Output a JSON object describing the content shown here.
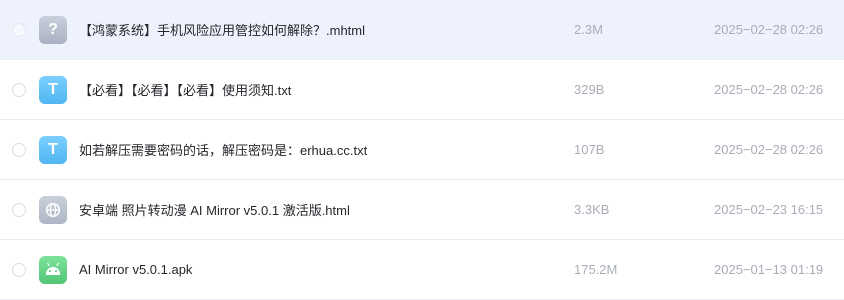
{
  "files": [
    {
      "name": "【鸿蒙系统】手机风险应用管控如何解除？.mhtml",
      "size": "2.3M",
      "date": "2025−02−28 02:26",
      "icon": "unknown-file-icon",
      "icon_glyph": "?",
      "selected": true
    },
    {
      "name": "【必看】【必看】【必看】使用须知.txt",
      "size": "329B",
      "date": "2025−02−28 02:26",
      "icon": "text-file-icon",
      "icon_glyph": "T",
      "selected": false
    },
    {
      "name": "如若解压需要密码的话，解压密码是：erhua.cc.txt",
      "size": "107B",
      "date": "2025−02−28 02:26",
      "icon": "text-file-icon",
      "icon_glyph": "T",
      "selected": false
    },
    {
      "name": "安卓端 照片转动漫 AI Mirror v5.0.1 激活版.html",
      "size": "3.3KB",
      "date": "2025−02−23 16:15",
      "icon": "web-file-icon",
      "icon_glyph": "",
      "selected": false
    },
    {
      "name": "AI Mirror v5.0.1.apk",
      "size": "175.2M",
      "date": "2025−01−13 01:19",
      "icon": "android-file-icon",
      "icon_glyph": "",
      "selected": false
    }
  ],
  "colors": {
    "selected_row_bg": "#eef2fd",
    "row_divider": "#ebedf2",
    "name_text": "#25262b",
    "meta_text": "#a9adb7",
    "txt_icon": "#4fb6f2",
    "apk_icon": "#52c677",
    "generic_icon": "#aab2c2"
  }
}
